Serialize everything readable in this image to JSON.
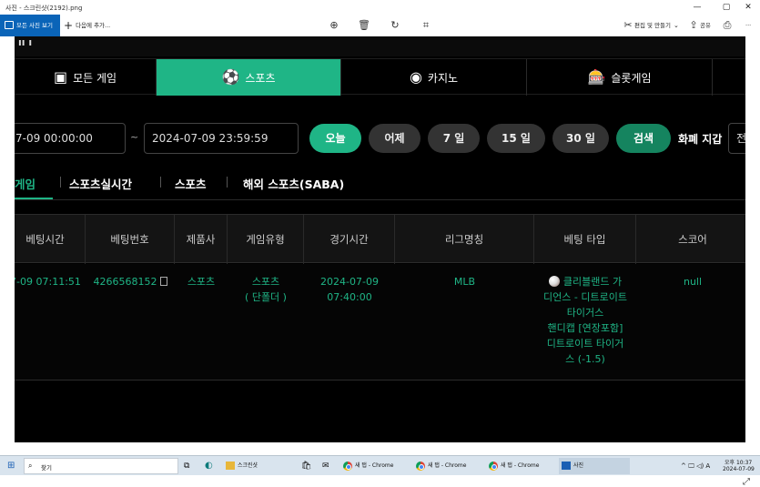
{
  "window": {
    "title": "사진 - 스크린샷(2192).png",
    "minimize": "—",
    "maximize": "▢",
    "close": "✕"
  },
  "toolbar": {
    "all_photos": "모든 사진 보기",
    "add_to": "다음에 추가...",
    "edit_create": "편집 및 만들기",
    "share": "공유",
    "more": "···"
  },
  "site": {
    "top_strip_text": "ıı ı",
    "nav_tabs": [
      {
        "label": "모든 게임",
        "icon": "grid-icon",
        "active": false
      },
      {
        "label": "스포츠",
        "icon": "soccer-ball-icon",
        "active": true
      },
      {
        "label": "카지노",
        "icon": "casino-chip-icon",
        "active": false
      },
      {
        "label": "슬롯게임",
        "icon": "slot-machine-icon",
        "active": false
      }
    ],
    "filter": {
      "date_from": "7-09 00:00:00",
      "tilde": "~",
      "date_to": "2024-07-09 23:59:59",
      "buttons": [
        "오늘",
        "어제",
        "7 일",
        "15 일",
        "30 일",
        "검색"
      ],
      "currency_label": "화폐 지갑",
      "currency_value": "전"
    },
    "subtabs": [
      "게임",
      "스포츠실시간",
      "스포츠",
      "해외 스포츠(SABA)"
    ],
    "table": {
      "headers": [
        "베팅시간",
        "베팅번호",
        "제품사",
        "게임유형",
        "경기시간",
        "리그명칭",
        "베팅 타입",
        "스코어"
      ],
      "row": {
        "bet_time": "7-09 07:11:51",
        "bet_no": "4266568152",
        "provider": "스포츠",
        "game_type": "스포츠\n( 단폴더 )",
        "match_time": "2024-07-09\n07:40:00",
        "league": "MLB",
        "bet_type": "클리블랜드 가\n디언스 - 디트로이트\n타이거스\n핸디캡 [연장포함]\n디트로이트 타이거\n스 (-1.5)",
        "score": "null"
      }
    }
  },
  "taskbar": {
    "search": "찾기",
    "explorer": "스크린샷",
    "chrome1": "새 탭 - Chrome",
    "chrome2": "새 탭 - Chrome",
    "chrome3": "새 탭 - Chrome",
    "photos": "사진",
    "tray": "^ 🖵 ◁) A",
    "clock_time": "오후 10:37",
    "clock_date": "2024-07-09"
  },
  "colors": {
    "accent": "#1fb586",
    "titlebar_blue": "#0a64b8"
  }
}
